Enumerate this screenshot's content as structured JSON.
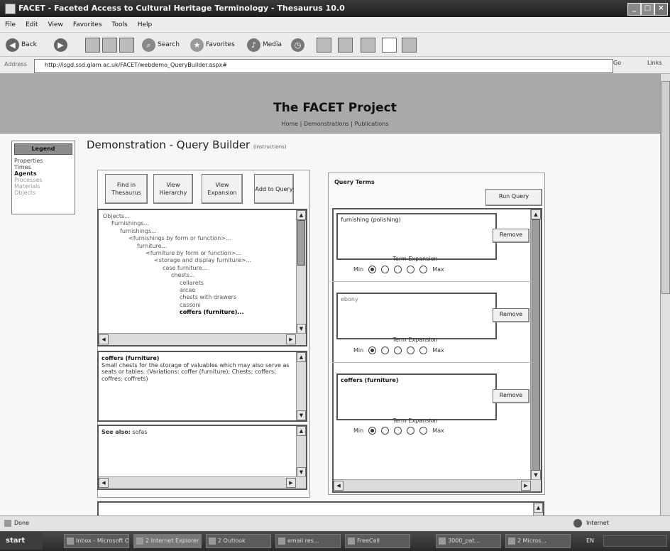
{
  "window": {
    "title": "FACET - Faceted Access to Cultural Heritage Terminology - Thesaurus 10.0",
    "buttons": [
      "_",
      "□",
      "×"
    ]
  },
  "menubar": [
    "File",
    "Edit",
    "View",
    "Favorites",
    "Tools",
    "Help"
  ],
  "toolbar": {
    "back": "Back",
    "search": "Search",
    "favorites": "Favorites",
    "media": "Media"
  },
  "address": {
    "label": "Address",
    "url": "http://isgd.ssd.glam.ac.uk/FACET/webdemo_QueryBuilder.aspx#",
    "go": "Go",
    "links": "Links"
  },
  "banner": {
    "title": "The FACET Project",
    "nav": "Home | Demonstrations | Publications"
  },
  "legend": {
    "heading": "Legend",
    "items": [
      "Properties",
      "Times",
      "Agents",
      "Processes",
      "Materials",
      "Objects"
    ]
  },
  "page": {
    "title": "Demonstration - Query Builder",
    "instructions": "(instructions)"
  },
  "left_buttons": [
    "Find in Thesaurus",
    "View Hierarchy",
    "View Expansion",
    "Add to Query"
  ],
  "tree": [
    "Objects...",
    "Furnishings...",
    "furnishings...",
    "<furnishings by form or function>...",
    "furniture...",
    "<furniture by form or function>...",
    "<storage and display furniture>...",
    "case furniture...",
    "chests...",
    "cellarets",
    "arcae",
    "chests with drawers",
    "cassoni",
    "coffers (furniture)..."
  ],
  "description": {
    "term": "coffers (furniture)",
    "text": "Small chests for the storage of valuables which may also serve as seats or tables. (Variations: coffer (furniture); Chests; coffers; coffres; coffrets)"
  },
  "see_also": {
    "label": "See also:",
    "value": "sofas"
  },
  "query_terms": {
    "heading": "Query Terms",
    "run_button": "Run Query",
    "remove_label": "Remove",
    "expansion_label": "Term Expansion",
    "min_label": "Min",
    "max_label": "Max",
    "terms": [
      {
        "term": "furnishing (polishing)",
        "selected": 0
      },
      {
        "term": "ebony",
        "selected": 0
      },
      {
        "term": "coffers (furniture)",
        "selected": 0
      }
    ]
  },
  "status": {
    "left": "Done",
    "right": "Internet"
  },
  "taskbar": {
    "start": "start",
    "tasks": [
      "Inbox - Microsoft Outlook",
      "2 Internet Explorer",
      "2 Outlook",
      "email res...",
      "FreeCell",
      "3000_pat...",
      "2 Micros..."
    ],
    "clock": "EN"
  }
}
